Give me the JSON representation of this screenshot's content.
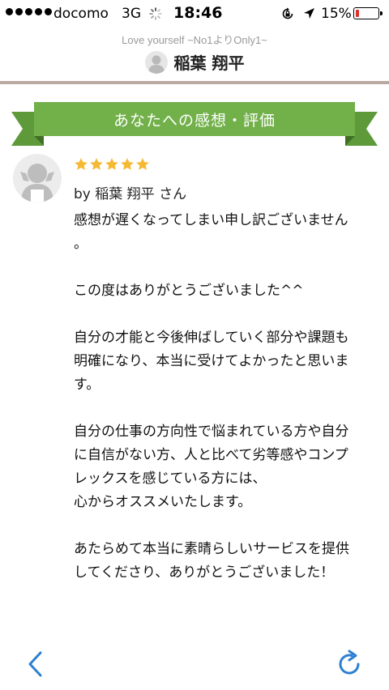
{
  "status_bar": {
    "carrier": "docomo",
    "network": "3G",
    "time": "18:46",
    "battery_percent": "15%",
    "battery_level": 0.15,
    "battery_color": "#e0302a"
  },
  "header": {
    "subtitle": "Love yourself ~No1よりOnly1~",
    "name": "稲葉 翔平"
  },
  "section": {
    "ribbon_title": "あなたへの感想・評価",
    "ribbon_color": "#72b04a"
  },
  "review": {
    "rating": 5,
    "max_rating": 5,
    "star_color": "#f5b932",
    "reviewer": "by 稲葉 翔平 さん",
    "paragraphs": [
      "感想が遅くなってしまい申し訳ございません\n。",
      "この度はありがとうございました^^",
      "自分の才能と今後伸ばしていく部分や課題も\n明確になり、本当に受けてよかったと思いま\nす。",
      "自分の仕事の方向性で悩まれている方や自分\nに自信がない方、人と比べて劣等感やコンプ\nレックスを感じている方には、\n心からオススメいたします。",
      "あたらめて本当に素晴らしいサービスを提供\nしてくださり、ありがとうございました！"
    ]
  },
  "toolbar": {
    "back_icon": "chevron-left-icon",
    "reload_icon": "reload-icon",
    "icon_color": "#2d7fd2"
  }
}
